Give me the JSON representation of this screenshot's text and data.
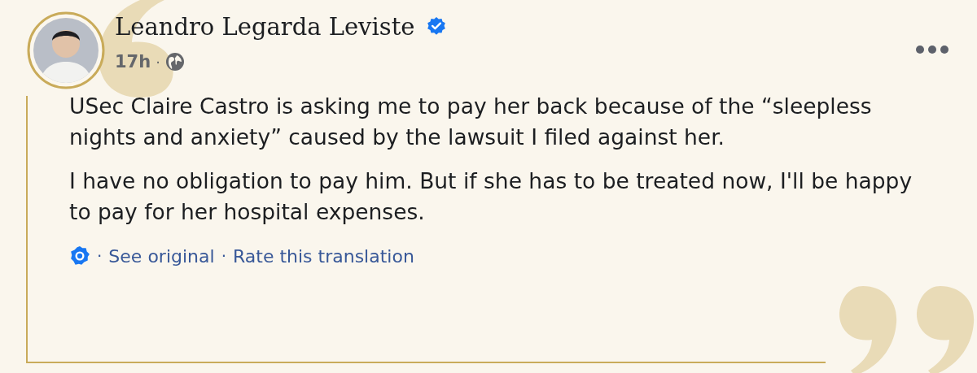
{
  "post": {
    "author": "Leandro Legarda Leviste",
    "verified": true,
    "time": "17h",
    "separator": "·",
    "paragraphs": [
      "USec Claire Castro is asking me to pay her back because of the “sleepless nights and anxiety” caused by the lawsuit I filed against her.",
      "I have no obligation to pay him. But if she has to be treated now, I'll be happy to pay for her hospital expenses."
    ],
    "translation_links": [
      {
        "separator": "·",
        "label": "See original"
      },
      {
        "separator": "·",
        "label": "Rate this translation"
      }
    ]
  }
}
